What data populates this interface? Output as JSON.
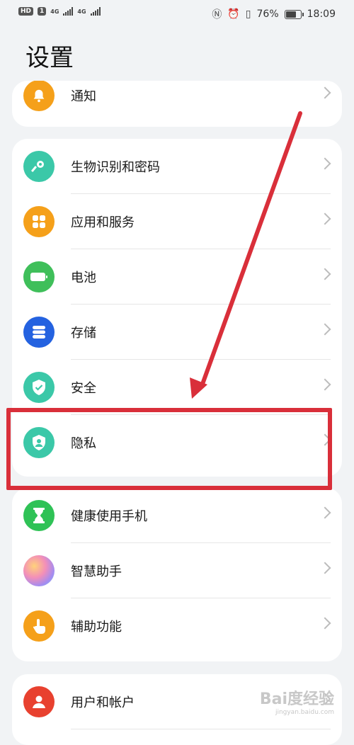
{
  "status_bar": {
    "left_badge": "HD",
    "sim1": "1",
    "net1": "4G",
    "net2": "4G",
    "battery_percent": "76%",
    "battery_level": 0.76,
    "time": "18:09",
    "icons": [
      "nfc-icon",
      "alarm-icon",
      "vibrate-icon"
    ]
  },
  "page_title": "设置",
  "groups": [
    {
      "items": [
        {
          "label": "通知",
          "icon": "bell-icon",
          "color": "#f5a01a"
        }
      ]
    },
    {
      "items": [
        {
          "label": "生物识别和密码",
          "icon": "key-icon",
          "color": "#3bc8a8"
        },
        {
          "label": "应用和服务",
          "icon": "apps-grid-icon",
          "color": "#f5a01a"
        },
        {
          "label": "电池",
          "icon": "battery-icon",
          "color": "#3fbf5a"
        },
        {
          "label": "存储",
          "icon": "storage-icon",
          "color": "#2462e0"
        },
        {
          "label": "安全",
          "icon": "shield-check-icon",
          "color": "#3bc8a8"
        },
        {
          "label": "隐私",
          "icon": "privacy-shield-icon",
          "color": "#3bc8a8"
        }
      ]
    },
    {
      "items": [
        {
          "label": "健康使用手机",
          "icon": "hourglass-icon",
          "color": "#2fc256"
        },
        {
          "label": "智慧助手",
          "icon": "assistant-orb-icon",
          "color": "#c9a0e8"
        },
        {
          "label": "辅助功能",
          "icon": "hand-pointer-icon",
          "color": "#f5a01a"
        }
      ]
    },
    {
      "items": [
        {
          "label": "用户和帐户",
          "icon": "user-icon",
          "color": "#e8412f"
        }
      ]
    }
  ],
  "annotation": {
    "arrow_color": "#d92f3a",
    "box_color": "#d92f3a",
    "highlighted_item": "隐私"
  },
  "watermark": {
    "text": "Bai度经验",
    "sub": "jingyan.baidu.com"
  }
}
